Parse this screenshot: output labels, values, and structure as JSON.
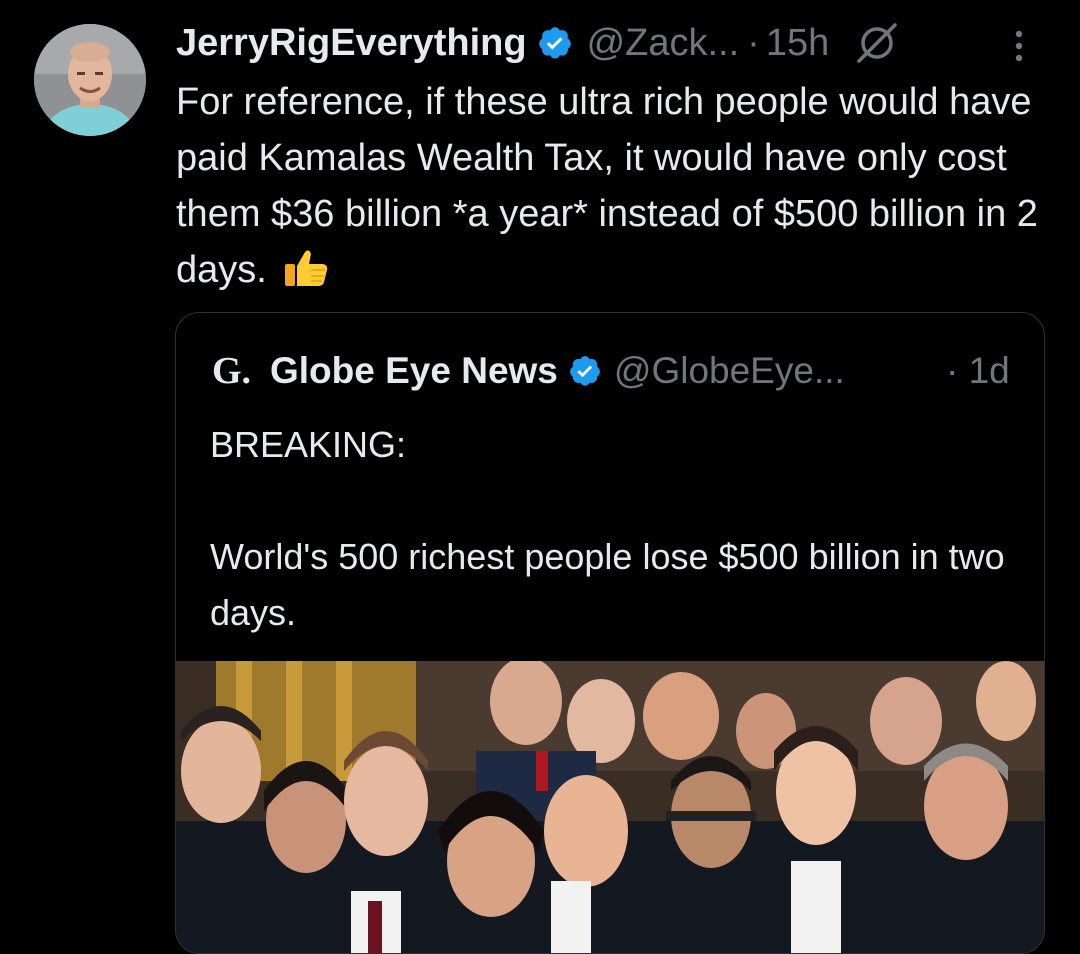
{
  "tweet": {
    "author_name": "JerryRigEverything",
    "author_handle": "@Zack...",
    "separator": "·",
    "time": "15h",
    "text": "For reference, if these ultra rich people would have paid Kamalas Wealth Tax, it would have only cost them $36 billion *a year* instead of $500 billion in 2 days.",
    "emoji": "thumbs-up",
    "icons": {
      "verified": "verified-badge-icon",
      "grok": "grok-icon",
      "more": "more-vertical-icon"
    },
    "colors": {
      "verified": "#1d9bf0",
      "muted": "#71767b",
      "text": "#e7e9ea",
      "background": "#000000"
    }
  },
  "quote": {
    "logo": "G.",
    "author_name": "Globe Eye News",
    "author_handle": "@GlobeEye...",
    "separator": "·",
    "time": "1d",
    "text": "BREAKING:\n\nWorld's 500 richest people lose $500 billion in two days."
  }
}
